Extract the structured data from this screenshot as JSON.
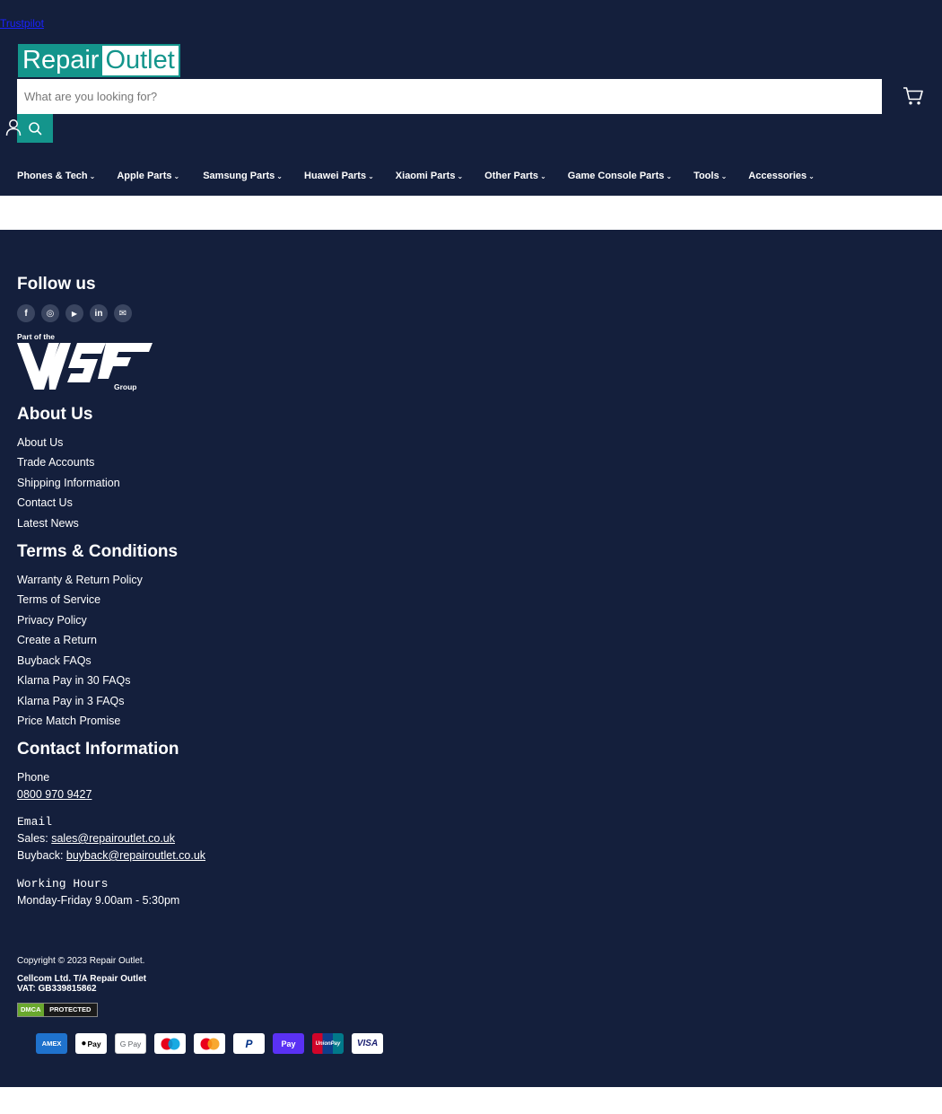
{
  "header": {
    "trustpilot_link": "Trustpilot",
    "logo": {
      "part1": "Repair",
      "part2": "Outlet"
    },
    "search": {
      "placeholder": "What are you looking for?"
    },
    "nav": [
      {
        "label": "Phones & Tech"
      },
      {
        "label": "Apple Parts"
      },
      {
        "label": "Samsung Parts"
      },
      {
        "label": "Huawei Parts"
      },
      {
        "label": "Xiaomi Parts"
      },
      {
        "label": "Other Parts"
      },
      {
        "label": "Game Console Parts"
      },
      {
        "label": "Tools"
      },
      {
        "label": "Accessories"
      }
    ],
    "icons": {
      "user": "user-icon",
      "search": "search-icon",
      "cart": "cart-icon",
      "chevron": "chevron-down-icon"
    }
  },
  "footer": {
    "follow_title": "Follow us",
    "socials": [
      {
        "icon": "facebook-icon",
        "glyph": "f"
      },
      {
        "icon": "instagram-icon",
        "glyph": "◎"
      },
      {
        "icon": "youtube-icon",
        "glyph": "▶"
      },
      {
        "icon": "linkedin-icon",
        "glyph": "in"
      },
      {
        "icon": "email-icon",
        "glyph": "✉"
      }
    ],
    "group_logo": {
      "top_text": "Part of the",
      "bottom_text": "Group"
    },
    "about": {
      "title": "About Us",
      "links": [
        "About Us",
        "Trade Accounts",
        "Shipping Information",
        "Contact Us",
        "Latest News"
      ]
    },
    "terms": {
      "title": "Terms & Conditions",
      "links": [
        "Warranty & Return Policy",
        "Terms of Service",
        "Privacy Policy",
        "Create a Return",
        "Buyback FAQs",
        "Klarna Pay in 30 FAQs",
        "Klarna Pay in 3 FAQs",
        "Price Match Promise"
      ]
    },
    "contact": {
      "title": "Contact Information",
      "phone_label": "Phone",
      "phone": "0800 970 9427",
      "email_label": "Email",
      "sales_label": "Sales:",
      "sales_email": "sales@repairoutlet.co.uk",
      "buyback_label": "Buyback:",
      "buyback_email": "buyback@repairoutlet.co.uk",
      "hours_label": "Working Hours",
      "hours": "Monday-Friday 9.00am - 5:30pm"
    },
    "copyright": "Copyright © 2023 Repair Outlet.",
    "company_line1": "Cellcom Ltd. T/A Repair Outlet",
    "company_line2": "VAT: GB339815862",
    "dmca": {
      "left": "DMCA",
      "right": "PROTECTED"
    },
    "payments": [
      {
        "name": "American Express",
        "text": "AMEX",
        "bg": "#1f72cd",
        "fg": "#ffffff"
      },
      {
        "name": "Apple Pay",
        "text": "Pay",
        "bg": "#ffffff",
        "fg": "#000000"
      },
      {
        "name": "Google Pay",
        "text": "G Pay",
        "bg": "#ffffff",
        "fg": "#5f6368"
      },
      {
        "name": "Maestro",
        "text": "",
        "bg": "#ffffff",
        "fg": "#000000"
      },
      {
        "name": "Mastercard",
        "text": "",
        "bg": "#ffffff",
        "fg": "#000000"
      },
      {
        "name": "PayPal",
        "text": "P",
        "bg": "#ffffff",
        "fg": "#003087"
      },
      {
        "name": "Shop Pay",
        "text": "Pay",
        "bg": "#5a31f4",
        "fg": "#ffffff"
      },
      {
        "name": "Union Pay",
        "text": "UnionPay",
        "bg": "#d10429",
        "fg": "#ffffff"
      },
      {
        "name": "Visa",
        "text": "VISA",
        "bg": "#ffffff",
        "fg": "#1a1f71"
      }
    ]
  },
  "colors": {
    "navy": "#141f3c",
    "teal": "#14958c",
    "white": "#ffffff"
  }
}
